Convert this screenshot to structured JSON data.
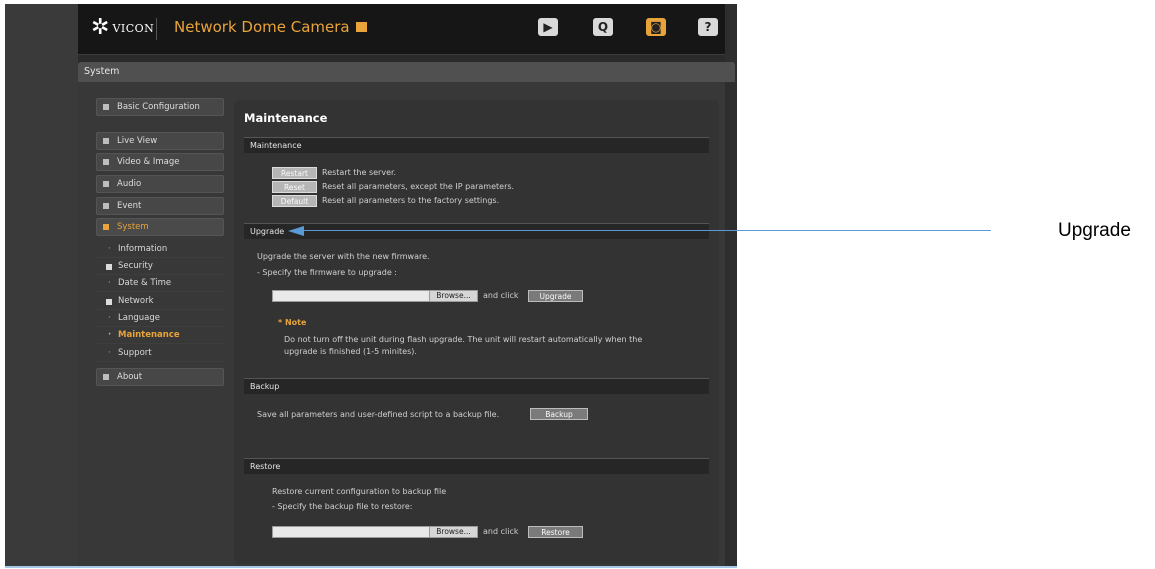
{
  "header": {
    "logo_text": "VICON",
    "product_title": "Network Dome Camera",
    "icons": [
      "live-view-icon",
      "search-icon",
      "setup-icon",
      "help-icon"
    ]
  },
  "section_title": "System",
  "nav": {
    "top": [
      {
        "label": "Basic Configuration"
      },
      {
        "label": "Live View"
      },
      {
        "label": "Video & Image"
      },
      {
        "label": "Audio"
      },
      {
        "label": "Event"
      },
      {
        "label": "System"
      }
    ],
    "sub": [
      {
        "label": "Information"
      },
      {
        "label": "Security"
      },
      {
        "label": "Date & Time"
      },
      {
        "label": "Network"
      },
      {
        "label": "Language"
      },
      {
        "label": "Maintenance"
      },
      {
        "label": "Support"
      }
    ],
    "about": "About"
  },
  "panel": {
    "title": "Maintenance",
    "maintenance": {
      "header": "Maintenance",
      "rows": [
        {
          "button": "Restart",
          "desc": "Restart the server."
        },
        {
          "button": "Reset",
          "desc": "Reset all parameters, except the IP parameters."
        },
        {
          "button": "Default",
          "desc": "Reset all parameters to the factory settings."
        }
      ]
    },
    "upgrade": {
      "header": "Upgrade",
      "line1": "Upgrade the server with the new firmware.",
      "line2": "- Specify the firmware to upgrade :",
      "browse": "Browse...",
      "and_click": "and click",
      "button": "Upgrade",
      "note_title": "* Note",
      "note_line1": "Do not turn off the unit during flash upgrade. The unit will restart automatically when the",
      "note_line2": "upgrade is finished (1-5 minites)."
    },
    "backup": {
      "header": "Backup",
      "text": "Save all parameters and user-defined script to a backup file.",
      "button": "Backup"
    },
    "restore": {
      "header": "Restore",
      "line1": "Restore current configuration to backup file",
      "line2": "- Specify the backup file to restore:",
      "browse": "Browse...",
      "and_click": "and click",
      "button": "Restore"
    }
  },
  "annotation": {
    "label": "Upgrade",
    "color": "#5b9bd5"
  },
  "colors": {
    "accent": "#e8a43b",
    "background": "#383838"
  }
}
